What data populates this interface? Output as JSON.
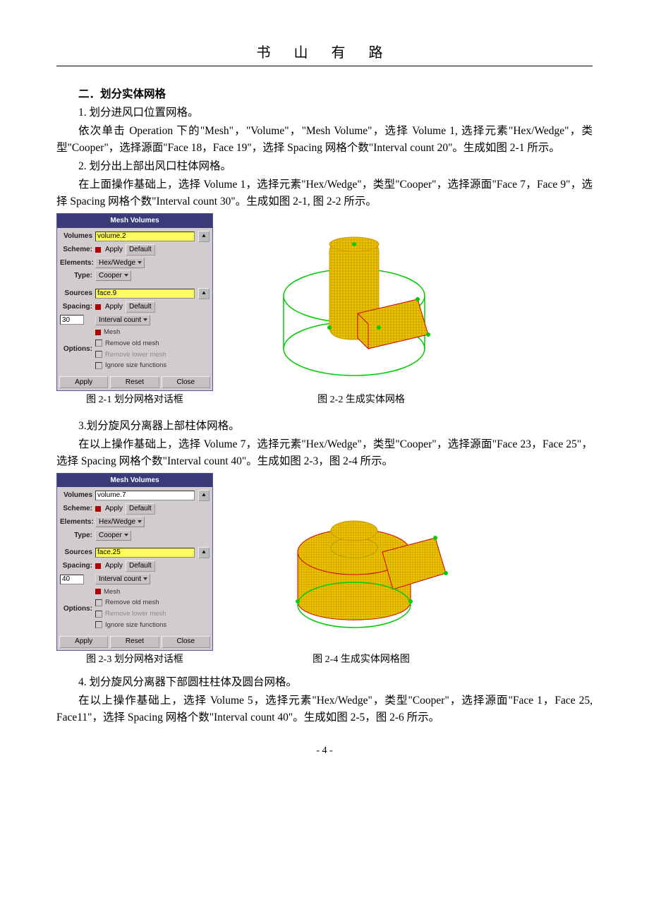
{
  "header": {
    "title": "书 山 有 路"
  },
  "section": {
    "heading": "二．划分实体网格",
    "step1_title": "1. 划分进风口位置网格。",
    "step1_body": "依次单击 Operation 下的\"Mesh\"，\"Volume\"，\"Mesh Volume\"，选择 Volume 1, 选择元素\"Hex/Wedge\"，类型\"Cooper\"，选择源面\"Face 18，Face 19\"，选择 Spacing 网格个数\"Interval count 20\"。生成如图 2-1 所示。",
    "step2_title": "2. 划分出上部出风口柱体网格。",
    "step2_body": "在上面操作基础上，选择 Volume 1，选择元素\"Hex/Wedge\"，类型\"Cooper\"，选择源面\"Face 7，Face 9\"，选择 Spacing 网格个数\"Interval count 30\"。生成如图 2-1, 图 2-2 所示。",
    "cap21": "图 2-1 划分网格对话框",
    "cap22": "图 2-2 生成实体网格",
    "step3_title": "3.划分旋风分离器上部柱体网格。",
    "step3_body": "在以上操作基础上，选择 Volume 7，选择元素\"Hex/Wedge\"，类型\"Cooper\"，选择源面\"Face 23，Face 25\"，选择 Spacing 网格个数\"Interval count 40\"。生成如图 2-3，图 2-4 所示。",
    "cap23": "图 2-3 划分网格对话框",
    "cap24": "图 2-4 生成实体网格图",
    "step4_title": "4. 划分旋风分离器下部圆柱柱体及圆台网格。",
    "step4_body": "在以上操作基础上，选择 Volume 5，选择元素\"Hex/Wedge\"，类型\"Cooper\"，选择源面\"Face 1，Face 25, Face11\"，选择 Spacing 网格个数\"Interval count 40\"。生成如图 2-5，图 2-6 所示。"
  },
  "dialog1": {
    "title": "Mesh Volumes",
    "volumes_label": "Volumes",
    "volumes_value": "volume.2",
    "scheme_label": "Scheme:",
    "apply": "Apply",
    "default": "Default",
    "elements_label": "Elements:",
    "elements_value": "Hex/Wedge",
    "type_label": "Type:",
    "type_value": "Cooper",
    "sources_label": "Sources",
    "sources_value": "face.9",
    "spacing_label": "Spacing:",
    "spacing_value": "30",
    "spacing_drop": "Interval count",
    "options_label": "Options:",
    "opt_mesh": "Mesh",
    "opt_remove_old": "Remove old mesh",
    "opt_remove_lower": "Remove lower mesh",
    "opt_ignore": "Ignore size functions",
    "btn_apply": "Apply",
    "btn_reset": "Reset",
    "btn_close": "Close"
  },
  "dialog2": {
    "title": "Mesh Volumes",
    "volumes_label": "Volumes",
    "volumes_value": "volume.7",
    "scheme_label": "Scheme:",
    "apply": "Apply",
    "default": "Default",
    "elements_label": "Elements:",
    "elements_value": "Hex/Wedge",
    "type_label": "Type:",
    "type_value": "Cooper",
    "sources_label": "Sources",
    "sources_value": "face.25",
    "spacing_label": "Spacing:",
    "spacing_value": "40",
    "spacing_drop": "Interval count",
    "options_label": "Options:",
    "opt_mesh": "Mesh",
    "opt_remove_old": "Remove old mesh",
    "opt_remove_lower": "Remove lower mesh",
    "opt_ignore": "Ignore size functions",
    "btn_apply": "Apply",
    "btn_reset": "Reset",
    "btn_close": "Close"
  },
  "page_number": "- 4 -"
}
